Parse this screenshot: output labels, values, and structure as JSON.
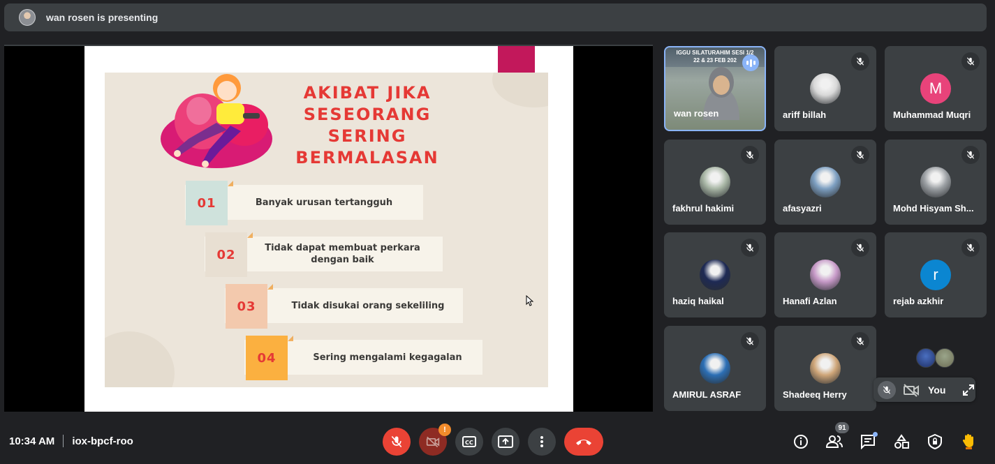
{
  "header": {
    "title": "wan rosen is presenting"
  },
  "slide": {
    "title_lines": [
      "AKIBAT JIKA",
      "SESEORANG",
      "SERING",
      "BERMALASAN"
    ],
    "steps": [
      {
        "number": "01",
        "text": "Banyak urusan tertangguh",
        "num_color": "#cfe2dc"
      },
      {
        "number": "02",
        "text": "Tidak dapat membuat perkara dengan baik",
        "num_color": "#e8dfd2"
      },
      {
        "number": "03",
        "text": "Tidak disukai orang sekeliling",
        "num_color": "#f3c9ad"
      },
      {
        "number": "04",
        "text": "Sering mengalami kegagalan",
        "num_color": "#fbb040"
      }
    ]
  },
  "presenter_tile": {
    "name": "wan rosen",
    "banner_line1": "IGGU SILATURAHIM SESI 1/2",
    "banner_line2": "22 & 23 FEB 202"
  },
  "participants": [
    {
      "name": "ariff billah",
      "avatar": "photo",
      "color": "#d8d8d8"
    },
    {
      "name": "Muhammad Muqri",
      "avatar": "M",
      "color": "#e8437a"
    },
    {
      "name": "fakhrul hakimi",
      "avatar": "photo",
      "color": "#a9b7a6"
    },
    {
      "name": "afasyazri",
      "avatar": "photo",
      "color": "#7ea0c2"
    },
    {
      "name": "Mohd Hisyam Sh...",
      "avatar": "photo",
      "color": "#9ca0a4"
    },
    {
      "name": "haziq haikal",
      "avatar": "photo",
      "color": "#1e2a55"
    },
    {
      "name": "Hanafi Azlan",
      "avatar": "photo",
      "color": "#c79ac8"
    },
    {
      "name": "rejab azkhir",
      "avatar": "r",
      "color": "#0b86d1"
    },
    {
      "name": "AMIRUL ASRAF",
      "avatar": "photo",
      "color": "#2c6fb5"
    },
    {
      "name": "Shadeeq Herry",
      "avatar": "photo",
      "color": "#cfa679"
    }
  ],
  "self_view": {
    "label": "You"
  },
  "footer": {
    "time": "10:34 AM",
    "meeting_code": "iox-bpcf-roo",
    "participant_count": "91",
    "camera_warning": "!"
  },
  "colors": {
    "accent": "#8ab4f8",
    "danger": "#ea4335",
    "surface": "#3c4043",
    "background": "#202124"
  },
  "icons": [
    "mic-off-icon",
    "camera-off-icon",
    "captions-icon",
    "present-icon",
    "more-options-icon",
    "end-call-icon",
    "info-icon",
    "people-icon",
    "chat-icon",
    "activities-icon",
    "host-controls-icon",
    "raise-hand-icon",
    "expand-icon",
    "speaking-icon"
  ]
}
